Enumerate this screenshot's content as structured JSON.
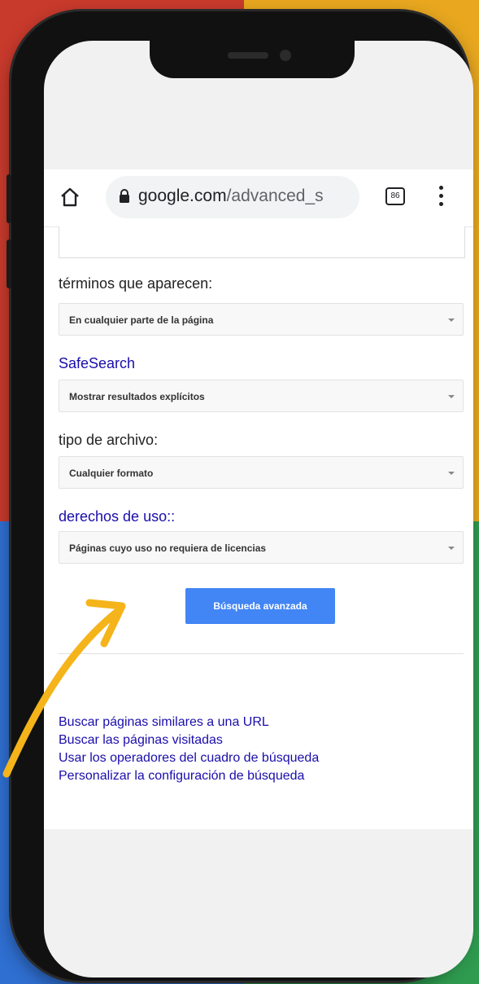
{
  "browser": {
    "url_domain": "google.com",
    "url_path": "/advanced_s",
    "tab_count": "86"
  },
  "form": {
    "terms_label": "términos que aparecen:",
    "terms_value": "En cualquier parte de la página",
    "safesearch_label": "SafeSearch",
    "safesearch_value": "Mostrar resultados explícitos",
    "filetype_label": "tipo de archivo:",
    "filetype_value": "Cualquier formato",
    "rights_label": "derechos de uso::",
    "rights_value": "Páginas cuyo uso no requiera de licencias",
    "submit_label": "Búsqueda avanzada"
  },
  "links": [
    "Buscar páginas similares a una URL",
    "Buscar las páginas visitadas",
    "Usar los operadores del cuadro de búsqueda",
    "Personalizar la configuración de búsqueda"
  ],
  "colors": {
    "link": "#1a0dab",
    "button": "#4285f4",
    "arrow": "#f4b41a"
  }
}
